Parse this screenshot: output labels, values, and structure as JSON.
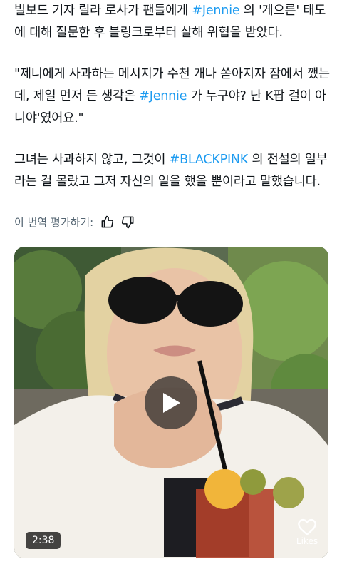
{
  "post": {
    "paragraph1": [
      {
        "text": "빌보드 기자 릴라 로사가 팬들에게 ",
        "tag": false
      },
      {
        "text": "#Jennie",
        "tag": true
      },
      {
        "text": " 의 '게으른' 태도에 대해 질문한 후 블링크로부터 살해 위협을 받았다.",
        "tag": false
      }
    ],
    "paragraph2": [
      {
        "text": "\"제니에게 사과하는 메시지가 수천 개나 쏟아지자 잠에서 깼는데, 제일 먼저 든 생각은 ",
        "tag": false
      },
      {
        "text": "#Jennie",
        "tag": true
      },
      {
        "text": " 가 누구야? 난 K팝 걸이 아니야'였어요.\"",
        "tag": false
      }
    ],
    "paragraph3": [
      {
        "text": "그녀는 사과하지 않고, 그것이 ",
        "tag": false
      },
      {
        "text": "#BLACKPINK",
        "tag": true
      },
      {
        "text": " 의 전설의 일부라는 걸 몰랐고 그저 자신의 일을 했을 뿐이라고 말했습니다.",
        "tag": false
      }
    ]
  },
  "translation": {
    "label": "이 번역 평가하기:",
    "thumbs_up_icon": "thumbs-up-icon",
    "thumbs_down_icon": "thumbs-down-icon"
  },
  "video": {
    "duration": "2:38",
    "likes_label": "Likes",
    "play_icon": "play-icon",
    "heart_icon": "heart-icon"
  },
  "colors": {
    "hashtag": "#1d9bf0",
    "text": "#0f1419",
    "muted": "#536471"
  }
}
